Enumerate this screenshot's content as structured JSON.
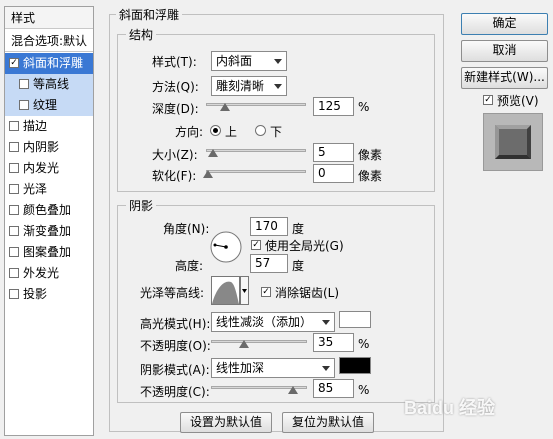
{
  "left_list": {
    "header": "样式",
    "blend_options": "混合选项:默认",
    "items": [
      {
        "label": "斜面和浮雕",
        "checked": true,
        "selected": true
      },
      {
        "label": "等高线",
        "checked": false,
        "sub": true
      },
      {
        "label": "纹理",
        "checked": false,
        "sub": true
      },
      {
        "label": "描边",
        "checked": false
      },
      {
        "label": "内阴影",
        "checked": false
      },
      {
        "label": "内发光",
        "checked": false
      },
      {
        "label": "光泽",
        "checked": false
      },
      {
        "label": "颜色叠加",
        "checked": false
      },
      {
        "label": "渐变叠加",
        "checked": false
      },
      {
        "label": "图案叠加",
        "checked": false
      },
      {
        "label": "外发光",
        "checked": false
      },
      {
        "label": "投影",
        "checked": false
      }
    ]
  },
  "bevel": {
    "group_title": "斜面和浮雕",
    "structure_title": "结构",
    "style_label": "样式(T):",
    "style_value": "内斜面",
    "technique_label": "方法(Q):",
    "technique_value": "雕刻清晰",
    "depth_label": "深度(D):",
    "depth_value": "125",
    "depth_fraction": 0.125,
    "depth_unit": "%",
    "direction_label": "方向:",
    "direction_up": "上",
    "direction_down": "下",
    "size_label": "大小(Z):",
    "size_value": "5",
    "size_unit": "像素",
    "soften_label": "软化(F):",
    "soften_value": "0",
    "soften_unit": "像素"
  },
  "shading": {
    "title": "阴影",
    "angle_label": "角度(N):",
    "angle_value": "170",
    "angle_unit": "度",
    "global_light_label": "使用全局光(G)",
    "global_light_checked": true,
    "altitude_label": "高度:",
    "altitude_value": "57",
    "altitude_unit": "度",
    "gloss_contour_label": "光泽等高线:",
    "antialias_label": "消除锯齿(L)",
    "antialias_checked": true,
    "highlight_mode_label": "高光模式(H):",
    "highlight_mode_value": "线性减淡（添加）",
    "highlight_color": "#ffffff",
    "highlight_opacity_label": "不透明度(O):",
    "highlight_opacity_value": "35",
    "highlight_opacity_unit": "%",
    "shadow_mode_label": "阴影模式(A):",
    "shadow_mode_value": "线性加深",
    "shadow_color": "#000000",
    "shadow_opacity_label": "不透明度(C):",
    "shadow_opacity_value": "85",
    "shadow_opacity_unit": "%"
  },
  "footer": {
    "make_default": "设置为默认值",
    "reset_default": "复位为默认值"
  },
  "right": {
    "ok": "确定",
    "cancel": "取消",
    "new_style": "新建样式(W)...",
    "preview_label": "预览(V)",
    "preview_checked": true
  },
  "watermark": "Baidu 经验"
}
